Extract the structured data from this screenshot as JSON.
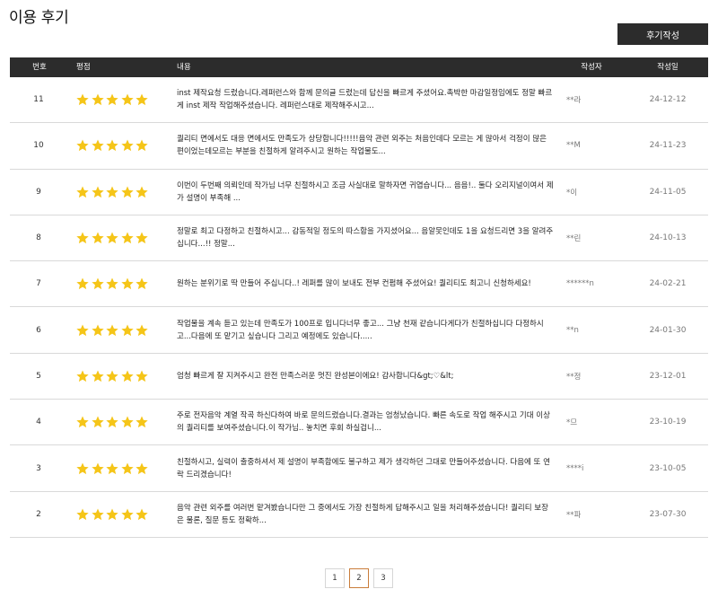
{
  "page": {
    "title": "이용 후기"
  },
  "toolbar": {
    "write_label": "후기작성"
  },
  "table": {
    "headers": {
      "no": "번호",
      "rating": "평점",
      "content": "내용",
      "author": "작성자",
      "date": "작성일"
    },
    "rows": [
      {
        "no": "11",
        "rating": 5,
        "content": "inst 제작요청 드렸습니다.레퍼런스와 함께 문의글 드렸는데 답신을 빠르게 주셨어요.촉박한 마감일정임에도 정말 빠르게 inst 제작 작업해주셨습니다. 레퍼런스대로 제작해주시고...",
        "author": "**라",
        "date": "24-12-12"
      },
      {
        "no": "10",
        "rating": 5,
        "content": "퀄리티 면에서도 대응 면에서도 만족도가 상당합니다!!!!!음악 관련 외주는 처음인데다 모르는 게 많아서 걱정이 많은 편이었는데모르는 부분을 친절하게 알려주시고 원하는 작업물도...",
        "author": "**M",
        "date": "24-11-23"
      },
      {
        "no": "9",
        "rating": 5,
        "content": "이번이 두번째 의뢰인데 작가님 너무 친절하시고 조금 사실대로 말하자면 귀엽습니다... 음음!.. 둘다 오리지널이여서 제가 설명이 부족해 ...",
        "author": "*이",
        "date": "24-11-05"
      },
      {
        "no": "8",
        "rating": 5,
        "content": "정말로 최고 다정하고 친절하시고... 감동적일 정도의 따스함을 가지셨어요... 음알못인데도 1을 요청드리면 3을 알려주십니다...!! 정말...",
        "author": "**린",
        "date": "24-10-13"
      },
      {
        "no": "7",
        "rating": 5,
        "content": "원하는 분위기로 딱 만들어 주십니다..! 레퍼를 많이 보내도 전부 컨펌해 주셨어요! 퀄리티도 최고니 신청하세요!",
        "author": "******n",
        "date": "24-02-21"
      },
      {
        "no": "6",
        "rating": 5,
        "content": "작업물을 계속 듣고 있는데 만족도가 100프로 입니다너무 좋고... 그냥 천재 같습니다게다가 친절하십니다 다정하시고...다음에 또 맡기고 싶습니다 그리고 예정에도 있습니다.....",
        "author": "**n",
        "date": "24-01-30"
      },
      {
        "no": "5",
        "rating": 5,
        "content": "엄청 빠르게 잘 지켜주시고 완전 만족스러운 멋진 완성본이에요! 감사합니다&gt;♡&lt;",
        "author": "**정",
        "date": "23-12-01"
      },
      {
        "no": "4",
        "rating": 5,
        "content": "주로 전자음악 계열 작곡 하신다하여 바로 문의드렸습니다.결과는 엄청났습니다. 빠른 속도로 작업 해주시고 기대 이상의 퀄리티를 보여주셨습니다.이 작가님.. 놓치면 후회 하실겁니...",
        "author": "*므",
        "date": "23-10-19"
      },
      {
        "no": "3",
        "rating": 5,
        "content": "친절하시고, 실력이 출중하셔서 제 설명이 부족함에도 불구하고 제가 생각하던 그대로 만들어주셨습니다. 다음에 또 연락 드리겠습니다!",
        "author": "****i",
        "date": "23-10-05"
      },
      {
        "no": "2",
        "rating": 5,
        "content": "음악 관련 외주를 여러번 맡겨봤습니다만 그 중에서도 가장 친절하게 답해주시고 일을 처리해주셨습니다! 퀄리티 보장은 물론, 질문 등도 정확하...",
        "author": "**파",
        "date": "23-07-30"
      }
    ]
  },
  "pagination": {
    "pages": [
      "1",
      "2",
      "3"
    ],
    "current": "2"
  },
  "colors": {
    "star": "#f5c518",
    "header_bg": "#2c2c2c",
    "active_page_border": "#c97d3a"
  }
}
